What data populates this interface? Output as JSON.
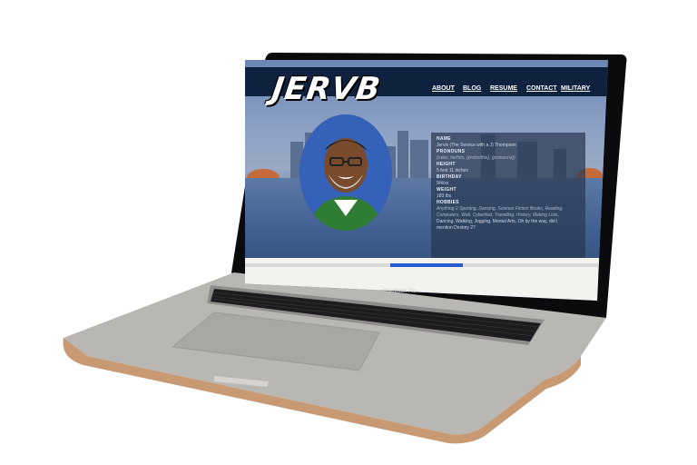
{
  "site": {
    "logo_text": "JERVB",
    "nav": [
      {
        "label": "ABOUT"
      },
      {
        "label": "BLOG"
      },
      {
        "label": "RESUME"
      },
      {
        "label": "CONTACT"
      },
      {
        "label": "MILITARY"
      }
    ],
    "info": {
      "name_label": "NAME",
      "name_value": "Jervis (The Service with a J) Thompson",
      "pronouns_label": "PRONOUNS",
      "pronouns_value": "(rules, he/him, (probs/this), (pronouns))",
      "height_label": "HEIGHT",
      "height_value": "5 feet 11 inches",
      "birthday_label": "BIRTHDAY",
      "birthday_value": "9/4/xx",
      "weight_label": "WEIGHT",
      "weight_value": "183 lbs",
      "hobbies_label": "HOBBIES",
      "hobbies_value_1": "Anything 2 Sporting, Dancing, Science Fiction Books, Reading,",
      "hobbies_value_2": "Computers, Wall, Cyberfied, Travelling, History, Making Lists,",
      "hobbies_value_3": "Dancing, Walking, Jogging, Mental Arts, Oh by the way, did I",
      "hobbies_value_4": "mention Destiny 2?"
    }
  },
  "laptop": {
    "brand_label": "MacBook Pro"
  },
  "colors": {
    "navbar": "#0e2240",
    "avatar_bg": "#3562b8",
    "info_panel": "#28374f",
    "progress_accent": "#2a5bd0",
    "laptop_body": "#b7b4b0"
  }
}
